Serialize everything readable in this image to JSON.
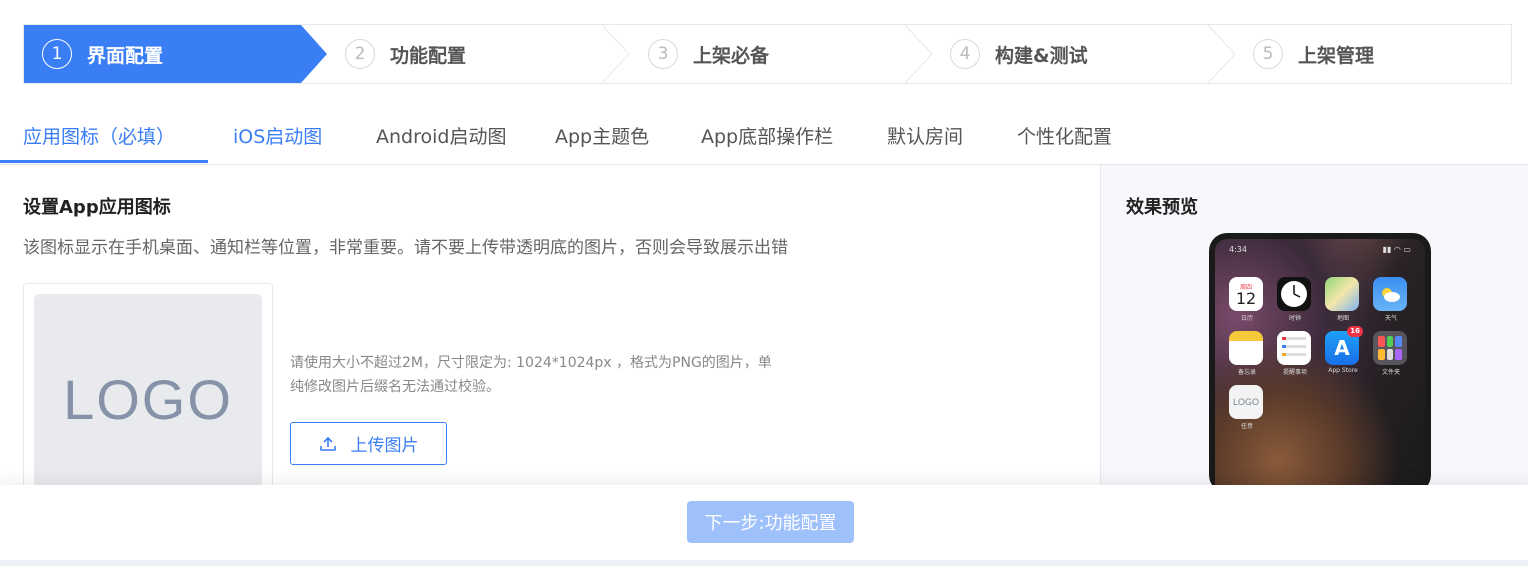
{
  "stepper": {
    "steps": [
      {
        "num": "1",
        "label": "界面配置"
      },
      {
        "num": "2",
        "label": "功能配置"
      },
      {
        "num": "3",
        "label": "上架必备"
      },
      {
        "num": "4",
        "label": "构建&测试"
      },
      {
        "num": "5",
        "label": "上架管理"
      }
    ],
    "active_index": 0,
    "accent": "#3a7ef6"
  },
  "tabs": [
    {
      "label": "应用图标（必填）"
    },
    {
      "label": "iOS启动图"
    },
    {
      "label": "Android启动图"
    },
    {
      "label": "App主题色"
    },
    {
      "label": "App底部操作栏"
    },
    {
      "label": "默认房间"
    },
    {
      "label": "个性化配置"
    }
  ],
  "section": {
    "title": "设置App应用图标",
    "description": "该图标显示在手机桌面、通知栏等位置，非常重要。请不要上传带透明底的图片，否则会导致展示出错",
    "logo_placeholder": "LOGO",
    "hint_line1": "请使用大小不超过2M，尺寸限定为: 1024*1024px ，格式为PNG的图片，单",
    "hint_line2": "纯修改图片后缀名无法通过校验。",
    "upload_label": "上传图片"
  },
  "preview": {
    "title": "效果预览",
    "time": "4:34",
    "apps": [
      {
        "name": "日历",
        "icon": "calendar-icon",
        "text": "12",
        "top": "周四"
      },
      {
        "name": "时钟",
        "icon": "clock-icon"
      },
      {
        "name": "地图",
        "icon": "maps-icon"
      },
      {
        "name": "天气",
        "icon": "weather-icon"
      },
      {
        "name": "备忘录",
        "icon": "notes-icon"
      },
      {
        "name": "提醒事项",
        "icon": "reminders-icon"
      },
      {
        "name": "App Store",
        "icon": "appstore-icon",
        "badge": "16"
      },
      {
        "name": "文件夹",
        "icon": "folder-icon"
      },
      {
        "name": "任意",
        "icon": "logo-app-icon",
        "text": "LOGO"
      }
    ]
  },
  "footer": {
    "next_label": "下一步:功能配置"
  }
}
